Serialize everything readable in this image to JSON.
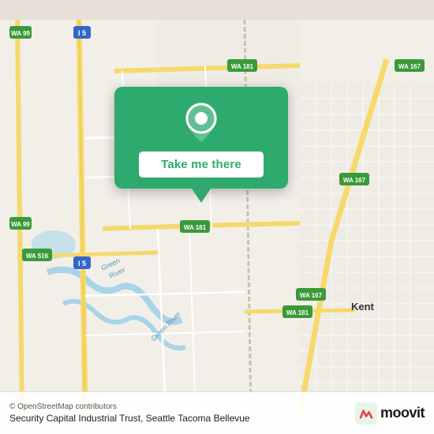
{
  "map": {
    "background_color": "#f2efe9",
    "attribution": "© OpenStreetMap contributors",
    "center_label": "Security Capital Industrial Trust, Seattle Tacoma Bellevue"
  },
  "popup": {
    "button_label": "Take me there",
    "location_icon": "location-pin-icon"
  },
  "moovit": {
    "logo_text": "moovit",
    "logo_icon": "moovit-brand-icon"
  },
  "roads": {
    "highway_color": "#f6d96b",
    "arterial_color": "#ffffff",
    "minor_color": "#e8e4de",
    "label_i5": "I 5",
    "label_wa99": "WA 99",
    "label_wa181_1": "WA 181",
    "label_wa181_2": "WA 181",
    "label_wa181_3": "WA 181",
    "label_wa167_1": "WA 167",
    "label_wa167_2": "WA 167",
    "label_wa167_3": "WA 167",
    "label_wa516": "WA 516",
    "label_i15": "I 5",
    "label_kent": "Kent"
  }
}
